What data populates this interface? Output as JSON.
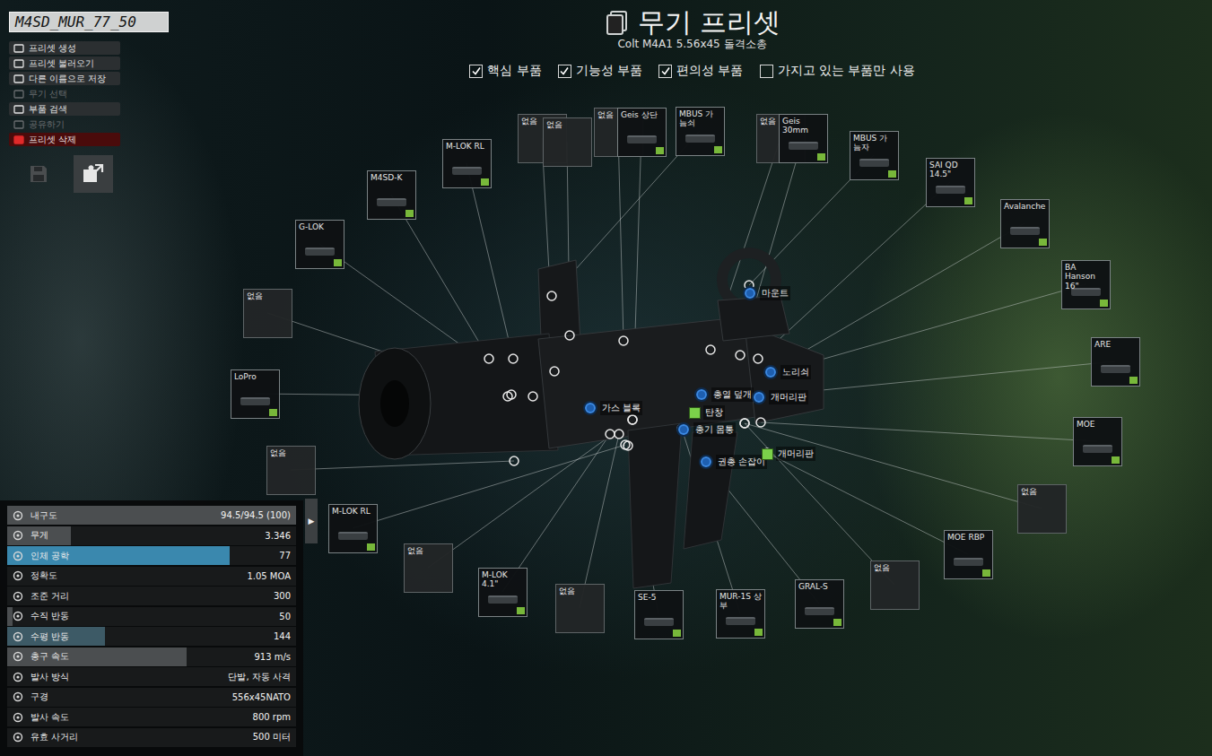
{
  "preset": {
    "name": "M4SD_MUR_77_50"
  },
  "menu": [
    {
      "label": "프리셋 생성",
      "disabled": false,
      "danger": false
    },
    {
      "label": "프리셋 불러오기",
      "disabled": false,
      "danger": false
    },
    {
      "label": "다른 이름으로 저장",
      "disabled": false,
      "danger": false
    },
    {
      "label": "무기 선택",
      "disabled": true,
      "danger": false
    },
    {
      "label": "부품 검색",
      "disabled": false,
      "danger": false
    },
    {
      "label": "공유하기",
      "disabled": true,
      "danger": false
    },
    {
      "label": "프리셋 삭제",
      "disabled": false,
      "danger": true
    }
  ],
  "tools": [
    {
      "name": "save",
      "disabled": true
    },
    {
      "name": "export",
      "disabled": false
    }
  ],
  "header": {
    "title": "무기 프리셋",
    "subtitle": "Colt M4A1 5.56x45 돌격소총"
  },
  "filters": [
    {
      "label": "핵심 부품",
      "checked": true
    },
    {
      "label": "기능성 부품",
      "checked": true
    },
    {
      "label": "편의성 부품",
      "checked": true
    },
    {
      "label": "가지고 있는 부품만 사용",
      "checked": false
    }
  ],
  "markers": [
    {
      "label": "마운트",
      "kind": "socket"
    },
    {
      "label": "노리쇠",
      "kind": "socket"
    },
    {
      "label": "총열 덮개",
      "kind": "socket"
    },
    {
      "label": "개머리판",
      "kind": "socket"
    },
    {
      "label": "가스 블록",
      "kind": "socket"
    },
    {
      "label": "탄창",
      "kind": "square"
    },
    {
      "label": "총기 몸통",
      "kind": "socket"
    },
    {
      "label": "권총 손잡이",
      "kind": "socket"
    },
    {
      "label": "개머리판",
      "kind": "square"
    }
  ],
  "slots": [
    {
      "name": "없음",
      "filled": false
    },
    {
      "name": "LoPro",
      "filled": true
    },
    {
      "name": "G-LOK",
      "filled": true
    },
    {
      "name": "M4SD-K",
      "filled": true
    },
    {
      "name": "M-LOK RL",
      "filled": true
    },
    {
      "name": "없음",
      "filled": false
    },
    {
      "name": "없음",
      "filled": false
    },
    {
      "name": "없음",
      "filled": false
    },
    {
      "name": "Geis 상단",
      "filled": true
    },
    {
      "name": "MBUS 가늠쇠",
      "filled": true
    },
    {
      "name": "없음",
      "filled": false
    },
    {
      "name": "Geis 30mm",
      "filled": true
    },
    {
      "name": "MBUS 가늠자",
      "filled": true
    },
    {
      "name": "SAI QD 14.5\"",
      "filled": true
    },
    {
      "name": "Avalanche",
      "filled": true
    },
    {
      "name": "BA Hanson 16\"",
      "filled": true
    },
    {
      "name": "ARE",
      "filled": true
    },
    {
      "name": "MOE",
      "filled": true
    },
    {
      "name": "없음",
      "filled": false
    },
    {
      "name": "MOE RBP",
      "filled": true
    },
    {
      "name": "없음",
      "filled": false
    },
    {
      "name": "GRAL-S",
      "filled": true
    },
    {
      "name": "MUR-1S 상부",
      "filled": true
    },
    {
      "name": "SE-5",
      "filled": true
    },
    {
      "name": "없음",
      "filled": false
    },
    {
      "name": "M-LOK 4.1\"",
      "filled": true
    },
    {
      "name": "없음",
      "filled": false
    },
    {
      "name": "M-LOK RL",
      "filled": true
    },
    {
      "name": "없음",
      "filled": false
    }
  ],
  "stats_tab": "▶",
  "stats": [
    {
      "label": "내구도",
      "value": "94.5/94.5 (100)",
      "kind": "bar",
      "level": 1.0,
      "color": "#4b4e50"
    },
    {
      "label": "무게",
      "value": "3.346",
      "kind": "bar",
      "level": 0.22,
      "color": "#4b4e50"
    },
    {
      "label": "인체 공학",
      "value": "77",
      "kind": "bar",
      "level": 0.77,
      "color": "#3a88ae"
    },
    {
      "label": "정확도",
      "value": "1.05 MOA",
      "kind": "text"
    },
    {
      "label": "조준 거리",
      "value": "300",
      "kind": "text"
    },
    {
      "label": "수직 반동",
      "value": "50",
      "kind": "bar",
      "level": 0.02,
      "color": "#4b4e50"
    },
    {
      "label": "수평 반동",
      "value": "144",
      "kind": "bar",
      "level": 0.34,
      "color": "#3d5a66"
    },
    {
      "label": "총구 속도",
      "value": "913 m/s",
      "kind": "bar",
      "level": 0.62,
      "color": "#4b4e50"
    },
    {
      "label": "발사 방식",
      "value": "단발, 자동 사격",
      "kind": "text"
    },
    {
      "label": "구경",
      "value": "556x45NATO",
      "kind": "text"
    },
    {
      "label": "발사 속도",
      "value": "800 rpm",
      "kind": "text"
    },
    {
      "label": "유효 사거리",
      "value": "500 미터",
      "kind": "text"
    }
  ]
}
